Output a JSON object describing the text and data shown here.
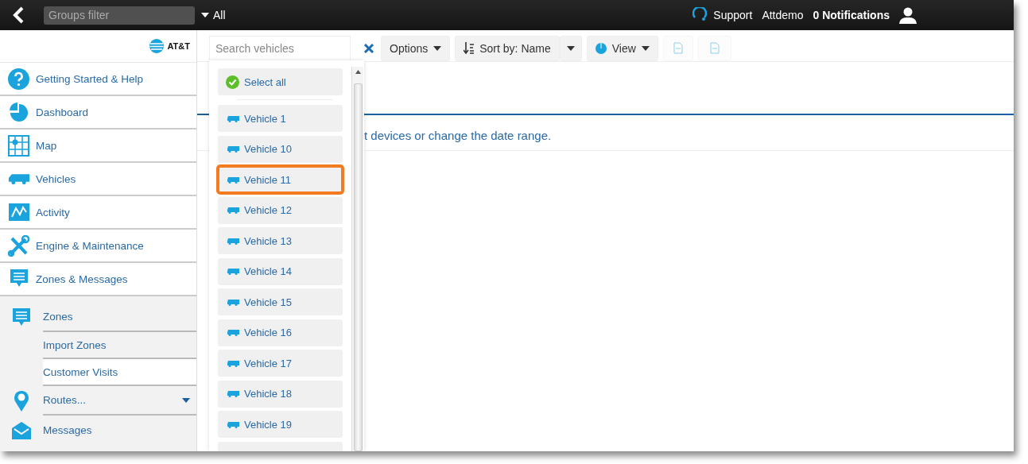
{
  "top_bar": {
    "groups_filter": {
      "placeholder": "Groups filter"
    },
    "group_selector": "All",
    "links": [
      {
        "label": "Support",
        "kind": "support"
      },
      {
        "label": "Attdemo",
        "kind": "plain"
      },
      {
        "label": "0 Notifications",
        "kind": "bold"
      }
    ]
  },
  "sidebar": {
    "logo": "AT&T",
    "items": [
      {
        "label": "Getting Started & Help",
        "selected": false
      },
      {
        "label": "Dashboard",
        "selected": false
      },
      {
        "label": "Map",
        "selected": false
      },
      {
        "label": "Vehicles",
        "selected": false
      },
      {
        "label": "Activity",
        "selected": false
      },
      {
        "label": "Engine & Maintenance",
        "selected": false
      },
      {
        "label": "Zones & Messages",
        "selected": false,
        "expanded": true,
        "children": [
          {
            "label": "Zones",
            "kind": "main",
            "selected": false
          },
          {
            "label": "Import Zones",
            "kind": "sub",
            "selected": false
          },
          {
            "label": "Customer Visits",
            "kind": "sub",
            "selected": true
          },
          {
            "label": "Routes...",
            "kind": "submenu",
            "selected": false
          },
          {
            "label": "Messages",
            "kind": "main",
            "selected": false
          }
        ]
      }
    ]
  },
  "toolbar": {
    "search": {
      "placeholder": "Search vehicles"
    },
    "buttons": [
      {
        "label": "Options",
        "kind": "menu",
        "disabled": false
      },
      {
        "label": "Sort by: Name",
        "kind": "sort",
        "disabled": false
      },
      {
        "label": "View",
        "kind": "view",
        "disabled": false
      },
      {
        "kind": "pdf",
        "disabled": true
      },
      {
        "kind": "xls",
        "disabled": true
      }
    ]
  },
  "vehicle_dropdown": {
    "select_all": "Select all",
    "items": [
      {
        "label": "Vehicle 1",
        "selected": false
      },
      {
        "label": "Vehicle 10",
        "selected": false
      },
      {
        "label": "Vehicle 11",
        "selected": true
      },
      {
        "label": "Vehicle 12",
        "selected": false
      },
      {
        "label": "Vehicle 13",
        "selected": false
      },
      {
        "label": "Vehicle 14",
        "selected": false
      },
      {
        "label": "Vehicle 15",
        "selected": false
      },
      {
        "label": "Vehicle 16",
        "selected": false
      },
      {
        "label": "Vehicle 17",
        "selected": false
      },
      {
        "label": "Vehicle 18",
        "selected": false
      },
      {
        "label": "Vehicle 19",
        "selected": false
      }
    ]
  },
  "content": {
    "message": "t devices or change the date range."
  }
}
